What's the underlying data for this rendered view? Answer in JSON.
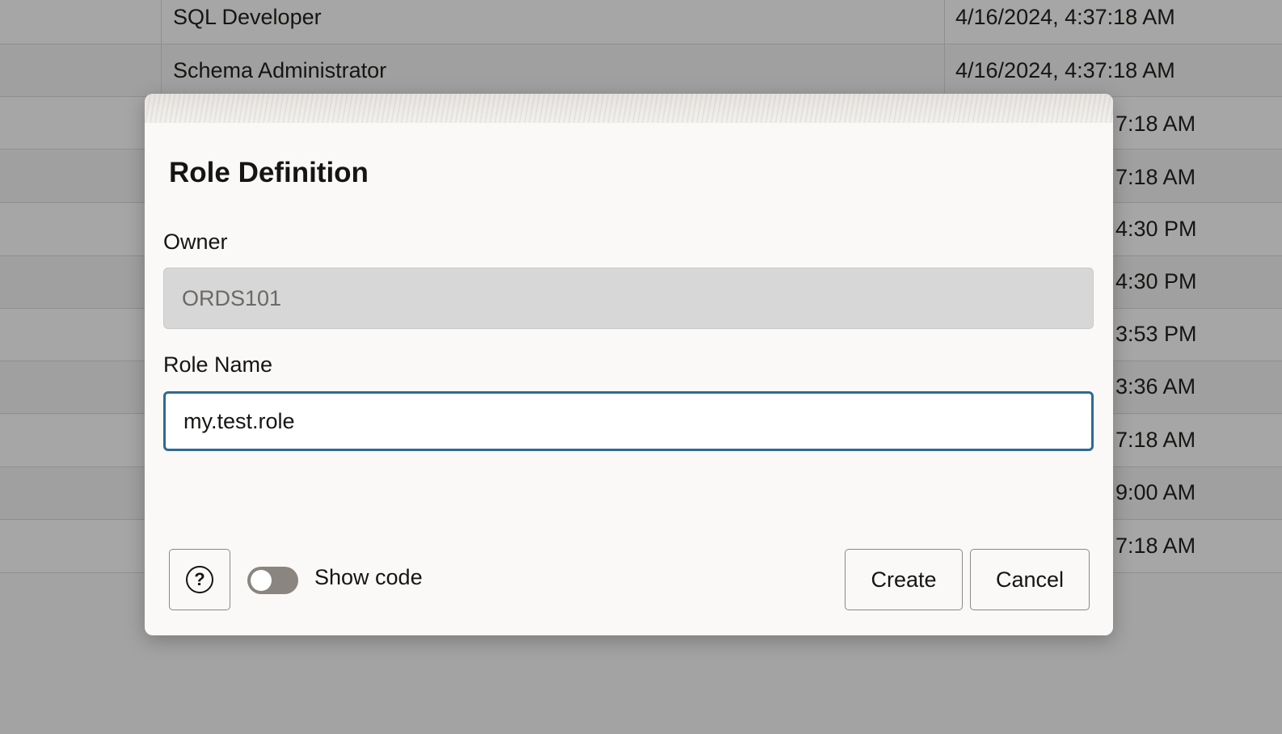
{
  "background_table": {
    "rows": [
      {
        "name": "SQL Developer",
        "date": "4/16/2024, 4:37:18 AM"
      },
      {
        "name": "Schema Administrator",
        "date": "4/16/2024, 4:37:18 AM"
      },
      {
        "name": "",
        "date": "7:18 AM"
      },
      {
        "name": "",
        "date": "7:18 AM"
      },
      {
        "name": "",
        "date": "4:30 PM"
      },
      {
        "name": "",
        "date": "4:30 PM"
      },
      {
        "name": "",
        "date": "3:53 PM"
      },
      {
        "name": "",
        "date": "3:36 AM"
      },
      {
        "name": "",
        "date": "7:18 AM"
      },
      {
        "name": "",
        "date": "9:00 AM"
      },
      {
        "name": "",
        "date": "7:18 AM"
      }
    ]
  },
  "dialog": {
    "title": "Role Definition",
    "owner": {
      "label": "Owner",
      "value": "ORDS101",
      "disabled": true
    },
    "role_name": {
      "label": "Role Name",
      "value": "my.test.role",
      "focused": true
    },
    "footer": {
      "help_icon": "question-circle-icon",
      "help_glyph": "?",
      "show_code_label": "Show code",
      "show_code_enabled": false,
      "create_label": "Create",
      "cancel_label": "Cancel"
    }
  },
  "colors": {
    "focus_border": "#2f6a92",
    "dialog_bg": "#faf9f7",
    "overlay_bg": "#a5a5a5",
    "toggle_off": "#8b8580"
  }
}
